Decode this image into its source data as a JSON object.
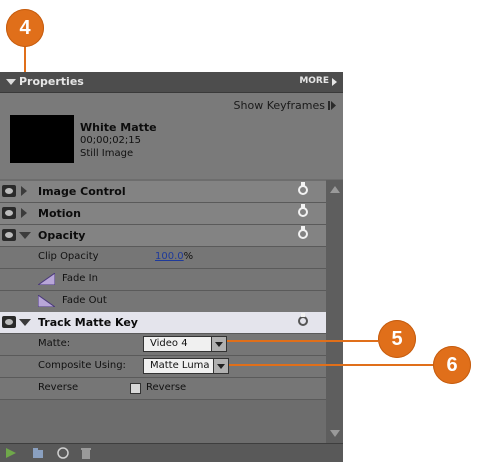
{
  "callouts": {
    "c4": "4",
    "c5": "5",
    "c6": "6"
  },
  "panel": {
    "title": "Properties",
    "more": "MORE"
  },
  "clip": {
    "show_keyframes": "Show Keyframes",
    "name": "White Matte",
    "timecode": "00;00;02;15",
    "type": "Still Image"
  },
  "effects": {
    "image_control": "Image Control",
    "motion": "Motion",
    "opacity": "Opacity",
    "clip_opacity_label": "Clip Opacity",
    "clip_opacity_value": "100.0",
    "clip_opacity_unit": "%",
    "fade_in": "Fade In",
    "fade_out": "Fade Out",
    "track_matte_key": "Track Matte Key",
    "matte_label": "Matte:",
    "matte_value": "Video 4",
    "composite_label": "Composite Using:",
    "composite_value": "Matte Luma",
    "reverse_label": "Reverse",
    "reverse_checkbox_label": "Reverse"
  },
  "colors": {
    "callout": "#e06f1a",
    "panel_bg": "#6d6d6d",
    "selected_row": "#e4e4ec"
  }
}
